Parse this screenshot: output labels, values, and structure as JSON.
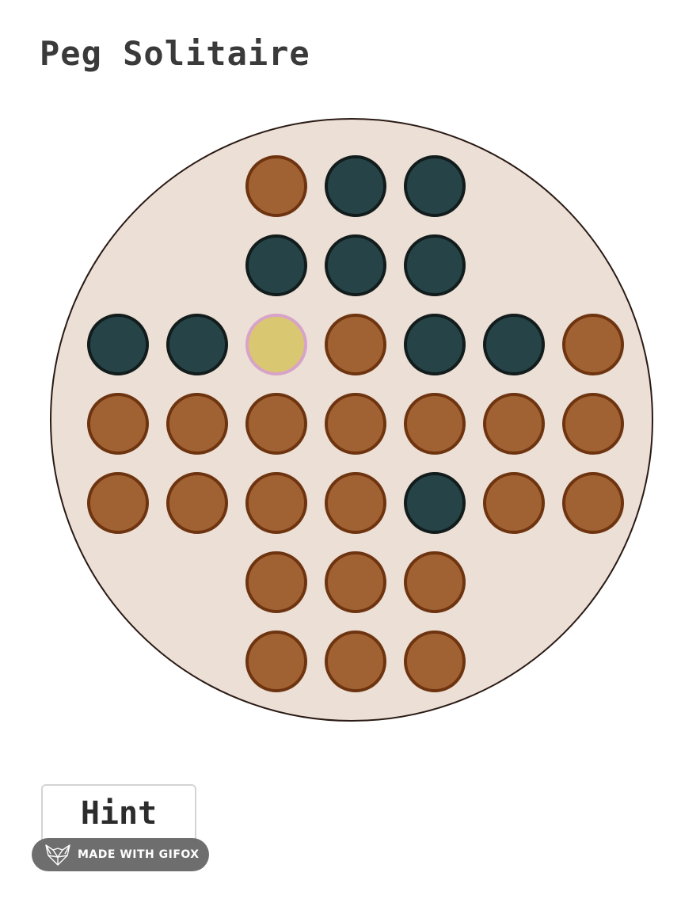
{
  "title": "Peg Solitaire",
  "board": {
    "rows": [
      [
        "off",
        "off",
        "peg",
        "empty",
        "empty",
        "off",
        "off"
      ],
      [
        "off",
        "off",
        "empty",
        "empty",
        "empty",
        "off",
        "off"
      ],
      [
        "empty",
        "empty",
        "selected",
        "peg",
        "empty",
        "empty",
        "peg"
      ],
      [
        "peg",
        "peg",
        "peg",
        "peg",
        "peg",
        "peg",
        "peg"
      ],
      [
        "peg",
        "peg",
        "peg",
        "peg",
        "empty",
        "peg",
        "peg"
      ],
      [
        "off",
        "off",
        "peg",
        "peg",
        "peg",
        "off",
        "off"
      ],
      [
        "off",
        "off",
        "peg",
        "peg",
        "peg",
        "off",
        "off"
      ]
    ]
  },
  "hint_button": {
    "label": "Hint"
  },
  "badge": {
    "label": "MADE WITH GIFOX"
  },
  "colors": {
    "board": "#ebdfd6",
    "peg": "#a16233",
    "empty": "#264447",
    "selected": "#d9c772",
    "selected_ring": "#d8a3c8"
  },
  "icons": {
    "badge_logo": "fox-head-icon"
  }
}
